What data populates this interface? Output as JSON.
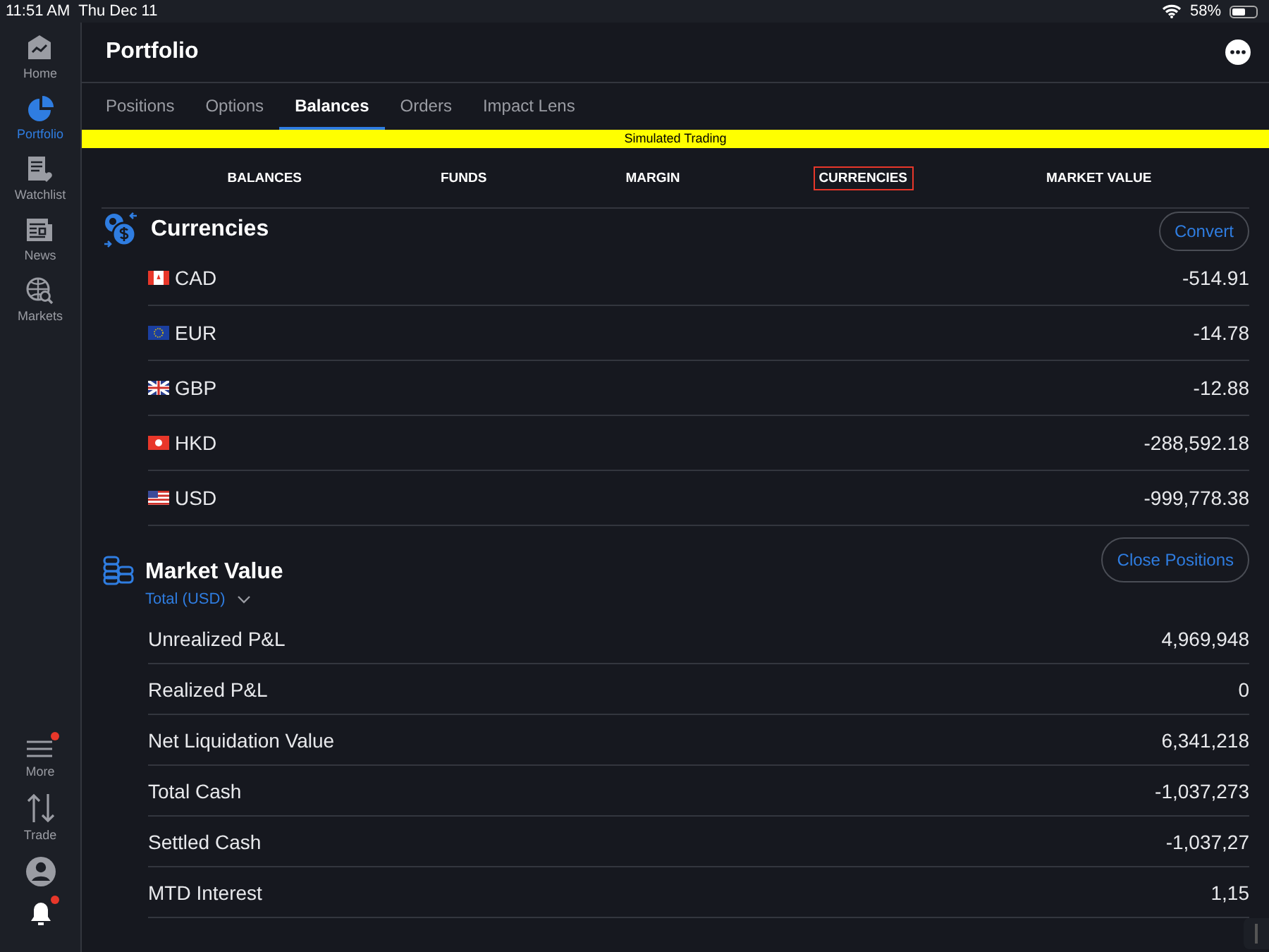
{
  "status_bar": {
    "time": "11:51 AM",
    "date": "Thu Dec 11",
    "battery_text": "58%"
  },
  "sidebar": {
    "items": [
      {
        "label": "Home",
        "kind": "home",
        "selected": false
      },
      {
        "label": "Portfolio",
        "kind": "portfolio",
        "selected": true
      },
      {
        "label": "Watchlist",
        "kind": "watchlist",
        "selected": false
      },
      {
        "label": "News",
        "kind": "news",
        "selected": false
      },
      {
        "label": "Markets",
        "kind": "markets",
        "selected": false
      }
    ],
    "bottom_items": [
      {
        "label": "More",
        "kind": "more",
        "badge": true
      },
      {
        "label": "Trade",
        "kind": "trade",
        "badge": false
      },
      {
        "kind": "profile",
        "badge": false
      },
      {
        "kind": "bell",
        "badge": true
      }
    ]
  },
  "header": {
    "title": "Portfolio"
  },
  "tabs": [
    {
      "label": "Positions",
      "selected": false
    },
    {
      "label": "Options",
      "selected": false
    },
    {
      "label": "Balances",
      "selected": true
    },
    {
      "label": "Orders",
      "selected": false
    },
    {
      "label": "Impact Lens",
      "selected": false
    }
  ],
  "banner": {
    "text": "Simulated Trading"
  },
  "subtabs": [
    {
      "label": "BALANCES",
      "selected": false
    },
    {
      "label": "FUNDS",
      "selected": false
    },
    {
      "label": "MARGIN",
      "selected": false
    },
    {
      "label": "CURRENCIES",
      "selected": true
    },
    {
      "label": "MARKET VALUE",
      "selected": false
    }
  ],
  "currencies": {
    "title": "Currencies",
    "button": "Convert",
    "rows": [
      {
        "code": "CAD",
        "kind": "ca",
        "value": "-514.91"
      },
      {
        "code": "EUR",
        "kind": "eu",
        "value": "-14.78"
      },
      {
        "code": "GBP",
        "kind": "gb",
        "value": "-12.88"
      },
      {
        "code": "HKD",
        "kind": "hk",
        "value": "-288,592.18"
      },
      {
        "code": "USD",
        "kind": "us",
        "value": "-999,778.38"
      }
    ]
  },
  "market_value": {
    "title": "Market Value",
    "selector": "Total (USD)",
    "button": "Close Positions",
    "rows": [
      {
        "label": "Unrealized P&L",
        "value": "4,969,948"
      },
      {
        "label": "Realized P&L",
        "value": "0"
      },
      {
        "label": "Net Liquidation Value",
        "value": "6,341,218"
      },
      {
        "label": "Total Cash",
        "value": "-1,037,273"
      },
      {
        "label": "Settled Cash",
        "value": "-1,037,27"
      },
      {
        "label": "MTD Interest",
        "value": "1,15"
      }
    ]
  }
}
